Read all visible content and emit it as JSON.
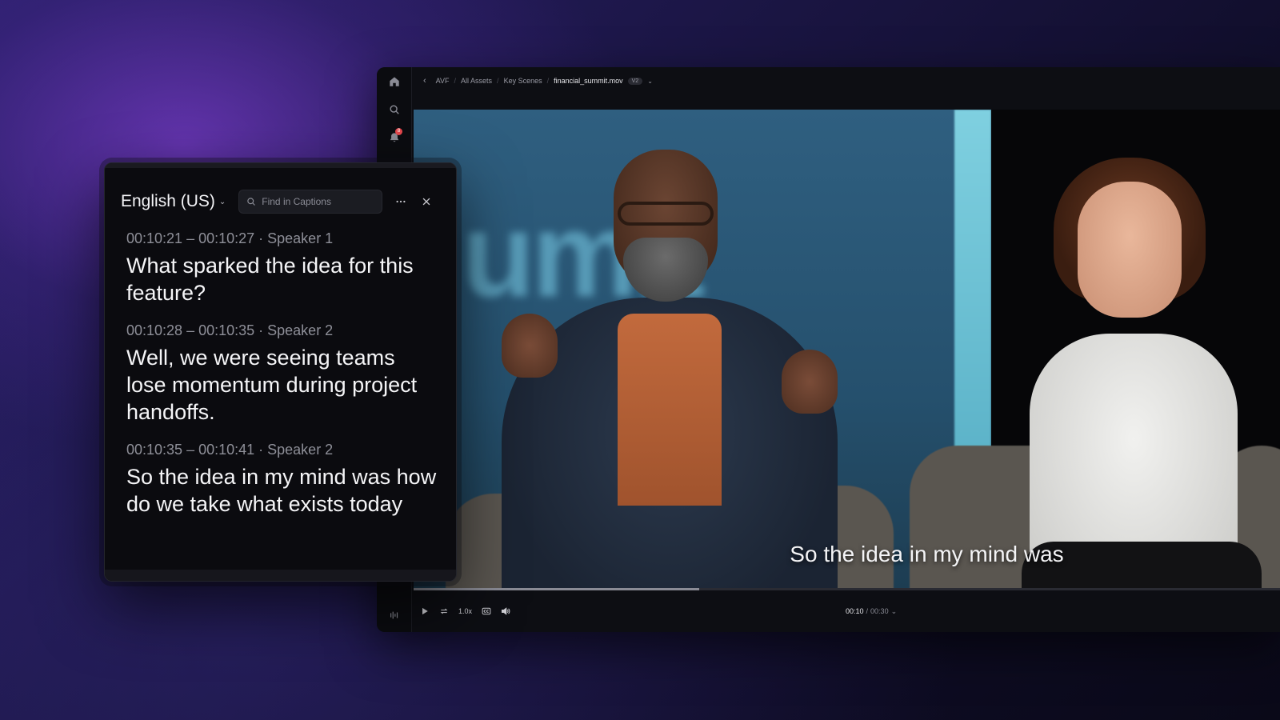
{
  "breadcrumb": {
    "items": [
      "AVF",
      "All Assets",
      "Key Scenes"
    ],
    "current": "financial_summit.mov",
    "version": "V2"
  },
  "rail": {
    "notification_count": "8"
  },
  "video": {
    "backdrop_word": "umit",
    "subtitle": "So the idea in my mind was",
    "progress_fraction": 0.33
  },
  "controls": {
    "speed": "1.0x",
    "current_time": "00:10",
    "separator": "/",
    "duration": "00:30"
  },
  "captions_panel": {
    "language": "English (US)",
    "search_placeholder": "Find in Captions",
    "items": [
      {
        "meta": "00:10:21 – 00:10:27 · Speaker 1",
        "text": "What sparked the idea for this feature?"
      },
      {
        "meta": "00:10:28 – 00:10:35 · Speaker 2",
        "text": "Well, we were seeing teams lose momentum during project handoffs."
      },
      {
        "meta": "00:10:35 – 00:10:41 · Speaker 2",
        "text": "So the idea in my mind was how do we take what exists today"
      }
    ]
  },
  "colors": {
    "accent_notification": "#e5484d",
    "panel_bg": "#0b0b0f",
    "app_bg": "#0d0e13"
  }
}
